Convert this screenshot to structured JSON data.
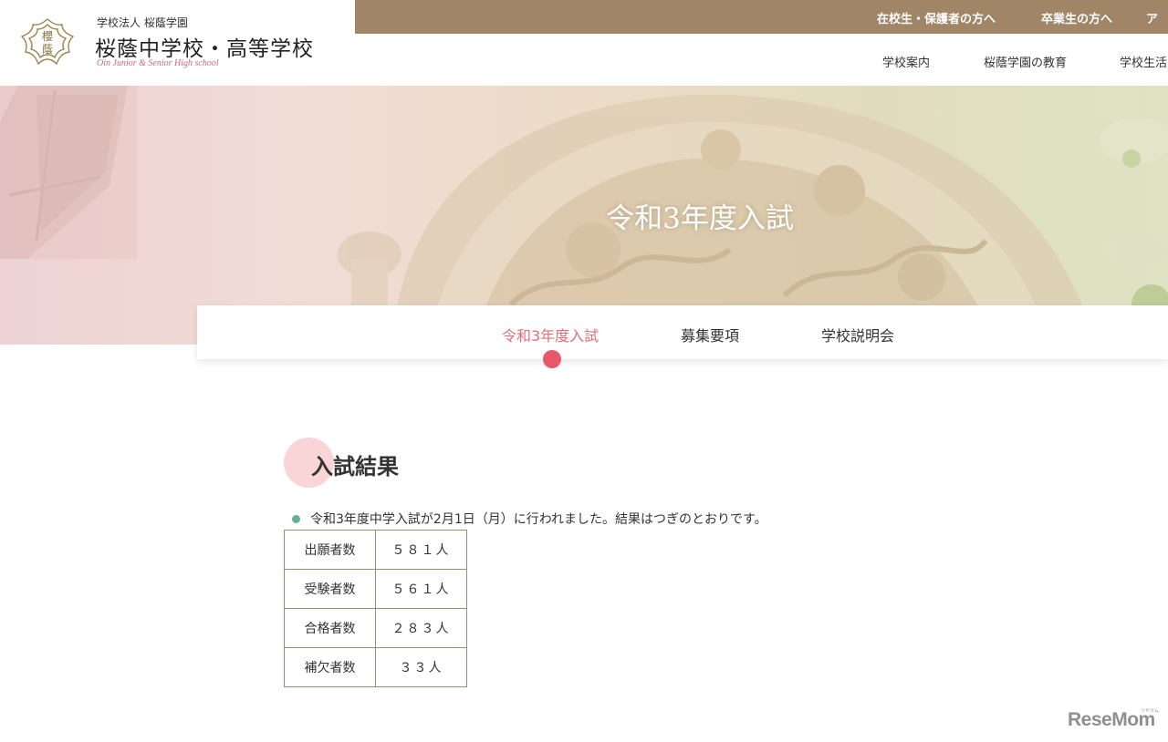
{
  "header": {
    "logo_small": "学校法人 桜蔭学園",
    "logo_name": "桜蔭中学校・高等学校",
    "logo_en": "Oin Junior & Senior High school",
    "logo_mark_text_top": "櫻",
    "logo_mark_text_bottom": "蔭",
    "topbar": [
      "在校生・保護者の方へ",
      "卒業生の方へ",
      "ア"
    ],
    "main_nav": [
      "学校案内",
      "桜蔭学園の教育",
      "学校生活"
    ]
  },
  "hero": {
    "title": "令和3年度入試"
  },
  "subnav": {
    "items": [
      "令和3年度入試",
      "募集要項",
      "学校説明会"
    ],
    "active_index": 0
  },
  "content": {
    "section_title": "入試結果",
    "notice": "令和3年度中学入試が2月1日（月）に行われました。結果はつぎのとおりです。",
    "results": [
      {
        "label": "出願者数",
        "value": "５８１人"
      },
      {
        "label": "受験者数",
        "value": "５６１人"
      },
      {
        "label": "合格者数",
        "value": "２８３人"
      },
      {
        "label": "補欠者数",
        "value": "３３人"
      }
    ]
  },
  "watermark": {
    "text": "ReseMom",
    "ruby": "リセマム"
  },
  "colors": {
    "topbar": "#a08567",
    "accent_pink": "#e16e7d",
    "dot_pink": "#e8586c",
    "bullet_green": "#5fb28e",
    "table_border": "#9d8a73"
  }
}
